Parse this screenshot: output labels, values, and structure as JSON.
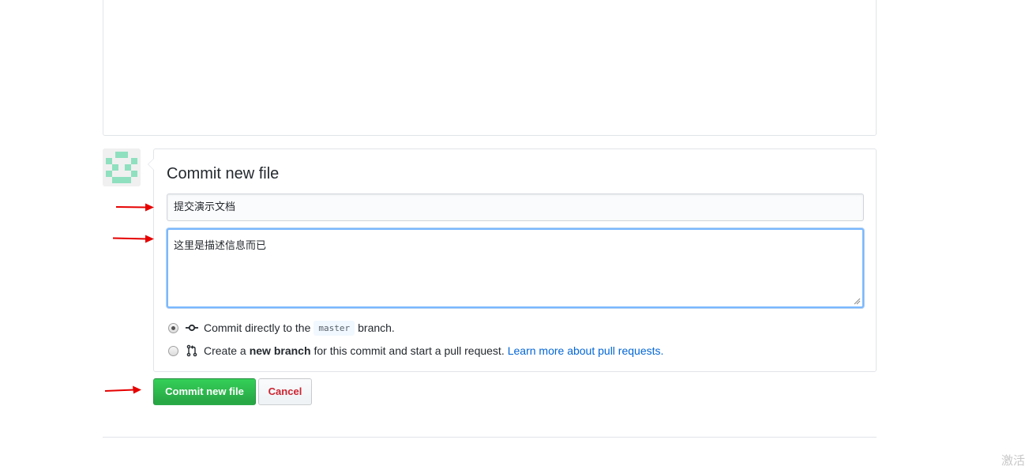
{
  "commit": {
    "title": "Commit new file",
    "summary_value": "提交演示文档",
    "description_value": "这里是描述信息而已",
    "options": [
      {
        "text_before": "Commit directly to the",
        "branch": "master",
        "text_after": "branch.",
        "checked": true,
        "icon": "git-commit-icon"
      },
      {
        "text_before": "Create a",
        "bold": "new branch",
        "text_after": "for this commit and start a pull request.",
        "link": "Learn more about pull requests.",
        "checked": false,
        "icon": "git-pull-request-icon"
      }
    ]
  },
  "buttons": {
    "commit_label": "Commit new file",
    "cancel_label": "Cancel"
  },
  "watermark": "激活",
  "colors": {
    "primary_green": "#28a745",
    "cancel_red": "#cb2431",
    "link_blue": "#0366d6",
    "focus_border": "#79b8ff",
    "annotation_arrow": "#e60000"
  }
}
